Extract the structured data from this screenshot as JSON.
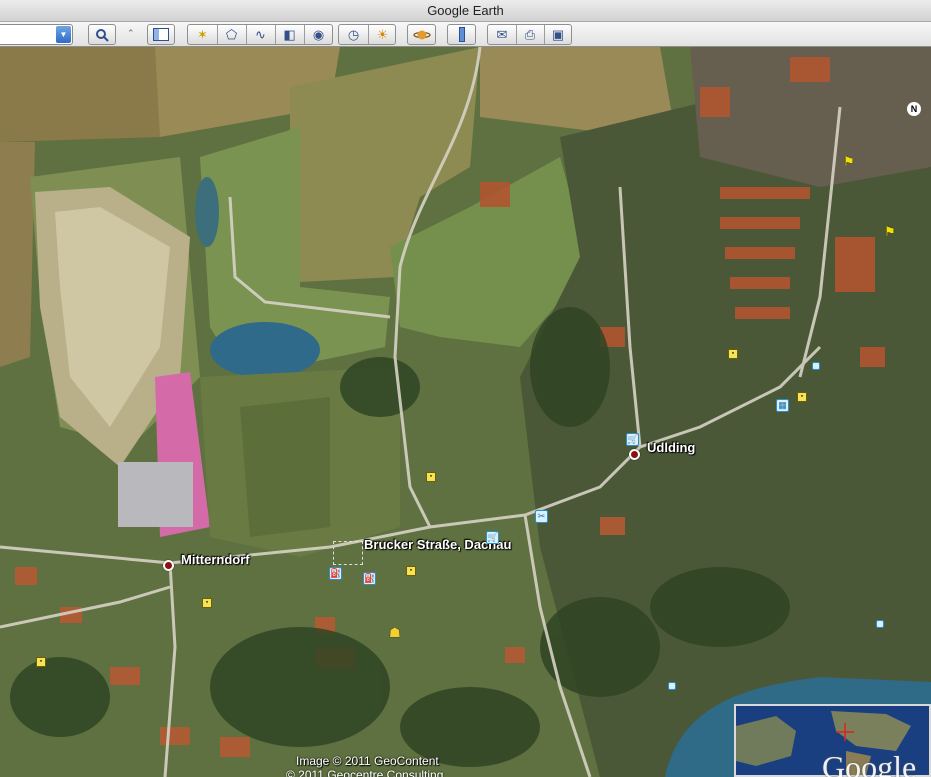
{
  "window": {
    "title": "Google Earth"
  },
  "toolbar": {
    "buttons": [
      {
        "name": "search-button",
        "icon": "magnifier-icon",
        "glyph": "🔍"
      },
      {
        "name": "sidebar-toggle-button",
        "icon": "sidebar-icon",
        "glyph": "▤"
      },
      {
        "name": "add-placemark-button",
        "icon": "placemark-icon",
        "glyph": "✶"
      },
      {
        "name": "add-polygon-button",
        "icon": "polygon-icon",
        "glyph": "⬠"
      },
      {
        "name": "add-path-button",
        "icon": "path-icon",
        "glyph": "∿"
      },
      {
        "name": "add-image-overlay-button",
        "icon": "image-overlay-icon",
        "glyph": "◧"
      },
      {
        "name": "record-tour-button",
        "icon": "tour-camera-icon",
        "glyph": "◉"
      },
      {
        "name": "historical-imagery-button",
        "icon": "clock-icon",
        "glyph": "◷"
      },
      {
        "name": "sunlight-button",
        "icon": "sunlight-icon",
        "glyph": "☀"
      },
      {
        "name": "switch-planet-button",
        "icon": "planet-icon",
        "glyph": "🪐"
      },
      {
        "name": "ruler-button",
        "icon": "ruler-icon",
        "glyph": "▮"
      },
      {
        "name": "email-button",
        "icon": "email-icon",
        "glyph": "✉"
      },
      {
        "name": "print-button",
        "icon": "print-icon",
        "glyph": "⎙"
      },
      {
        "name": "view-in-maps-button",
        "icon": "google-maps-icon",
        "glyph": "▣"
      }
    ]
  },
  "map": {
    "labels": {
      "udlding": "Udlding",
      "mitterndorf": "Mitterndorf",
      "brucker": "Brucker Straße, Dachau"
    },
    "north_label": "N",
    "credit_line1": "Image © 2011 GeoContent",
    "credit_line2": "© 2011 Geocentre Consulting",
    "brand": "Google"
  }
}
